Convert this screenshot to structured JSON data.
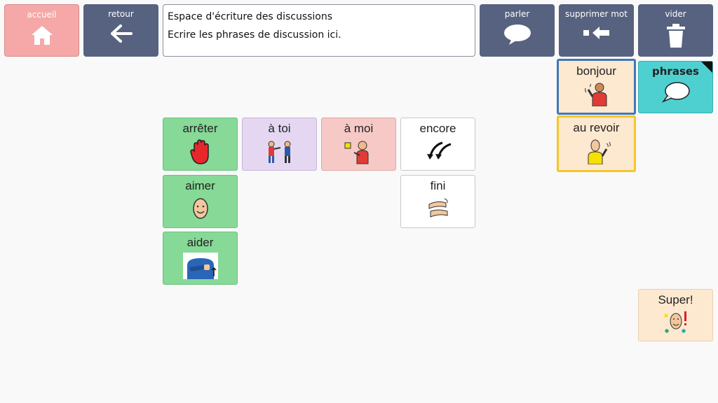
{
  "toolbar": {
    "home_label": "accueil",
    "back_label": "retour",
    "speak_label": "parler",
    "delete_word_label": "supprimer mot",
    "clear_label": "vider"
  },
  "message": {
    "line1": "Espace d'écriture des discussions",
    "line2": "Ecrire les phrases de discussion ici."
  },
  "tiles": {
    "stop": "arrêter",
    "to_you": "à toi",
    "to_me": "à moi",
    "more": "encore",
    "like": "aimer",
    "finished": "fini",
    "help": "aider",
    "hello": "bonjour",
    "phrases": "phrases",
    "goodbye": "au revoir",
    "great": "Super!"
  },
  "colors": {
    "toolbar_home": "#f6a8a8",
    "toolbar_slate": "#56627f",
    "tile_green": "#86d996",
    "tile_purple": "#e5d7f2",
    "tile_pink": "#f6c9c6",
    "tile_peach": "#fde8d0",
    "tile_teal": "#4ed0d1",
    "selected_blue": "#3f78b8",
    "selected_yellow": "#f5c52a"
  }
}
